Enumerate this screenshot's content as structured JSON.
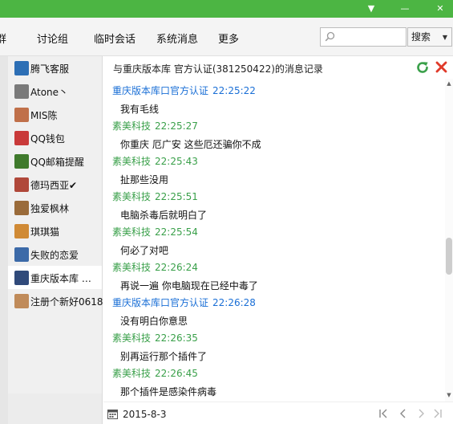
{
  "window": {
    "minimize_glyph": "▼",
    "maximize_glyph": "—",
    "close_glyph": "✕"
  },
  "toolbar": {
    "tabs": [
      {
        "label": "群"
      },
      {
        "label": "讨论组"
      },
      {
        "label": "临时会话"
      },
      {
        "label": "系统消息"
      },
      {
        "label": "更多"
      }
    ],
    "search": {
      "value": "",
      "placeholder": ""
    },
    "search_button_label": "搜索"
  },
  "contacts": [
    {
      "name": "腾飞客服",
      "avatar_color": "#2d6fb5"
    },
    {
      "name": "Atone丶",
      "avatar_color": "#7a7a7a"
    },
    {
      "name": "MIS陈",
      "avatar_color": "#c0704a"
    },
    {
      "name": "QQ钱包",
      "avatar_color": "#c93a3a"
    },
    {
      "name": "QQ邮箱提醒",
      "avatar_color": "#3f7a2c"
    },
    {
      "name": "德玛西亚✔",
      "avatar_color": "#b0483a"
    },
    {
      "name": "独爱枫林",
      "avatar_color": "#9a6b3a"
    },
    {
      "name": "琪琪猫",
      "avatar_color": "#d08a35"
    },
    {
      "name": "失败的恋爱",
      "avatar_color": "#3c6aa8"
    },
    {
      "name": "重庆版本库 …",
      "avatar_color": "#304a7a"
    },
    {
      "name": "注册个新好0618",
      "avatar_color": "#c08b5a"
    }
  ],
  "selected_contact_index": 9,
  "header": {
    "title": "与重庆版本库  官方认证(381250422)的消息记录"
  },
  "messages": [
    {
      "sender": "重庆版本库口官方认证",
      "time": "22:25:22",
      "text": "我有毛线",
      "side": "peer"
    },
    {
      "sender": "素美科技",
      "time": "22:25:27",
      "text": "你重庆 厄广安  这些厄还骗你不成",
      "side": "self"
    },
    {
      "sender": "素美科技",
      "time": "22:25:43",
      "text": "扯那些没用",
      "side": "self"
    },
    {
      "sender": "素美科技",
      "time": "22:25:51",
      "text": "电脑杀毒后就明白了",
      "side": "self"
    },
    {
      "sender": "素美科技",
      "time": "22:25:54",
      "text": "何必了对吧",
      "side": "self"
    },
    {
      "sender": "素美科技",
      "time": "22:26:24",
      "text": "再说一遍  你电脑现在已经中毒了",
      "side": "self"
    },
    {
      "sender": "重庆版本库口官方认证",
      "time": "22:26:28",
      "text": "没有明白你意思",
      "side": "peer"
    },
    {
      "sender": "素美科技",
      "time": "22:26:35",
      "text": "别再运行那个插件了",
      "side": "self"
    },
    {
      "sender": "素美科技",
      "time": "22:26:45",
      "text": "那个插件是感染件病毒",
      "side": "self"
    }
  ],
  "footer": {
    "date": "2015-8-3"
  },
  "colors": {
    "titlebar": "#4cb543",
    "peer_name": "#1a6fd6",
    "self_name": "#3aa04a",
    "refresh": "#3aa04a",
    "close": "#e03a2a"
  }
}
